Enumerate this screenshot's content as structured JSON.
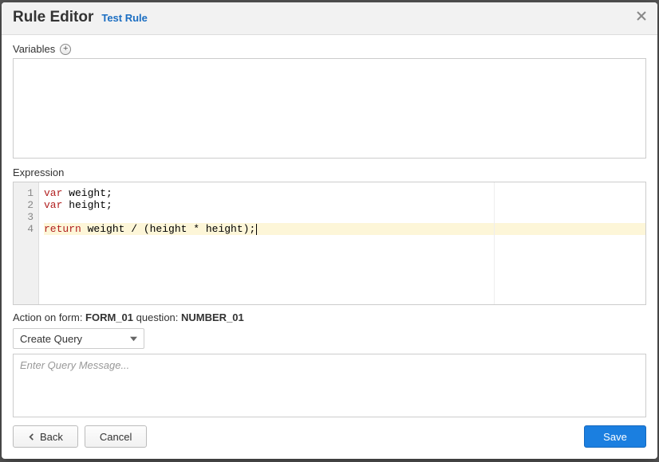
{
  "header": {
    "title": "Rule Editor",
    "test_link": "Test Rule"
  },
  "variables": {
    "label": "Variables"
  },
  "expression": {
    "label": "Expression",
    "code_lines": [
      {
        "n": 1,
        "kw": "var",
        "rest": " weight;",
        "active": false
      },
      {
        "n": 2,
        "kw": "var",
        "rest": " height;",
        "active": false
      },
      {
        "n": 3,
        "kw": "",
        "rest": "",
        "active": false
      },
      {
        "n": 4,
        "kw": "return",
        "rest": " weight / (height * height);",
        "active": true
      }
    ]
  },
  "action": {
    "prefix": "Action on form: ",
    "form": "FORM_01",
    "middle": " question: ",
    "question": "NUMBER_01",
    "select_value": "Create Query",
    "message_placeholder": "Enter Query Message..."
  },
  "footer": {
    "back": "Back",
    "cancel": "Cancel",
    "save": "Save"
  }
}
